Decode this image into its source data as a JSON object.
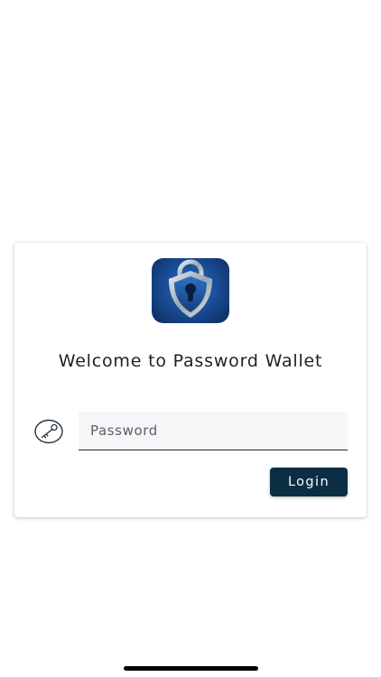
{
  "login_card": {
    "app_icon": "shield-lock-icon",
    "title": "Welcome to Password Wallet",
    "field_icon": "key-icon",
    "password_placeholder": "Password",
    "password_value": "",
    "login_label": "Login"
  },
  "colors": {
    "button_bg": "#0c2e42",
    "input_bg": "#f5f6f8",
    "icon_blue": "#1b4f9a"
  }
}
